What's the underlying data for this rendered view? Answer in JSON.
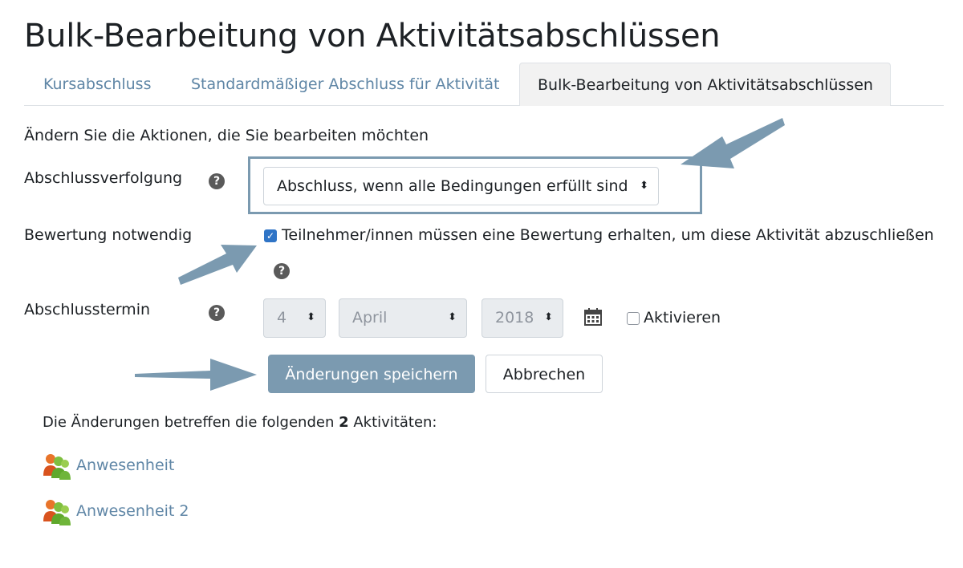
{
  "page": {
    "title": "Bulk-Bearbeitung von Aktivitätsabschlüssen"
  },
  "tabs": [
    {
      "label": "Kursabschluss",
      "active": false
    },
    {
      "label": "Standardmäßiger Abschluss für Aktivität",
      "active": false
    },
    {
      "label": "Bulk-Bearbeitung von Aktivitätsabschlüssen",
      "active": true
    }
  ],
  "form": {
    "intro": "Ändern Sie die Aktionen, die Sie bearbeiten möchten",
    "tracking": {
      "label": "Abschlussverfolgung",
      "value": "Abschluss, wenn alle Bedingungen erfüllt sind"
    },
    "grade": {
      "label": "Bewertung notwendig",
      "checked": true,
      "checkbox_text": "Teilnehmer/innen müssen eine Bewertung erhalten, um diese Aktivität abzuschließen"
    },
    "date": {
      "label": "Abschlusstermin",
      "day": "4",
      "month": "April",
      "year": "2018",
      "enable_label": "Aktivieren",
      "enabled": false
    },
    "save_label": "Änderungen speichern",
    "cancel_label": "Abbrechen"
  },
  "affected": {
    "prefix": "Die Änderungen betreffen die folgenden",
    "count": "2",
    "suffix": "Aktivitäten:",
    "items": [
      {
        "name": "Anwesenheit"
      },
      {
        "name": "Anwesenheit 2"
      }
    ]
  },
  "colors": {
    "accent": "#7b9ab0",
    "link": "#5f86a6",
    "checkbox": "#2f74c6"
  },
  "icons": {
    "help": "question-circle-icon",
    "calendar": "calendar-icon",
    "activity": "attendance-icon",
    "caret": "select-caret-icon"
  }
}
